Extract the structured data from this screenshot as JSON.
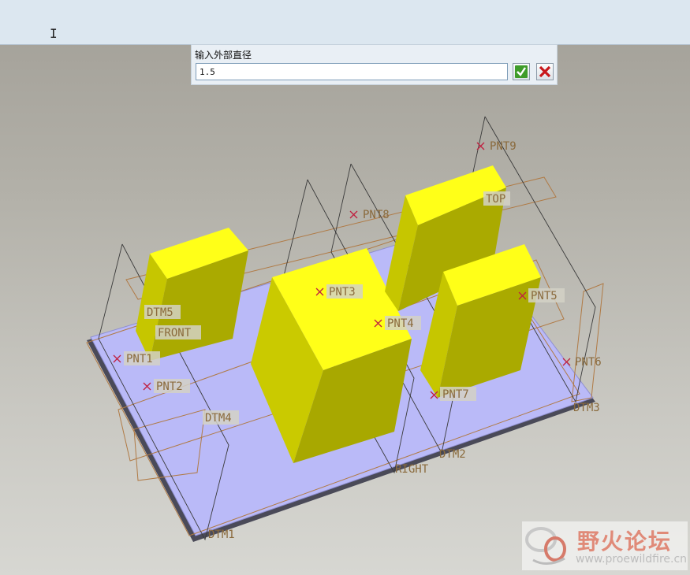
{
  "dialog": {
    "prompt": "输入外部直径",
    "value": "1.5",
    "ok_label": "✓",
    "cancel_label": "✕"
  },
  "cursor": {
    "glyph": "I"
  },
  "scene": {
    "labels": {
      "dtm5": "DTM5",
      "front": "FRONT",
      "pnt1": "PNT1",
      "pnt2": "PNT2",
      "dtm4": "DTM4",
      "dtm1": "DTM1",
      "pnt3": "PNT3",
      "pnt4": "PNT4",
      "pnt8": "PNT8",
      "pnt9": "PNT9",
      "top": "TOP",
      "pnt5": "PNT5",
      "pnt6": "PNT6",
      "pnt7": "PNT7",
      "dtm3": "DTM3",
      "dtm2": "DTM2",
      "right": "RIGHT"
    },
    "colors": {
      "plate": "#babaf8",
      "block_top": "#ffff10",
      "block_side": "#cccc00",
      "datum_edge": "#b07a45",
      "point_mark": "#c02040"
    }
  },
  "watermark": {
    "title": "野火论坛",
    "url": "www.proewildfire.cn"
  }
}
